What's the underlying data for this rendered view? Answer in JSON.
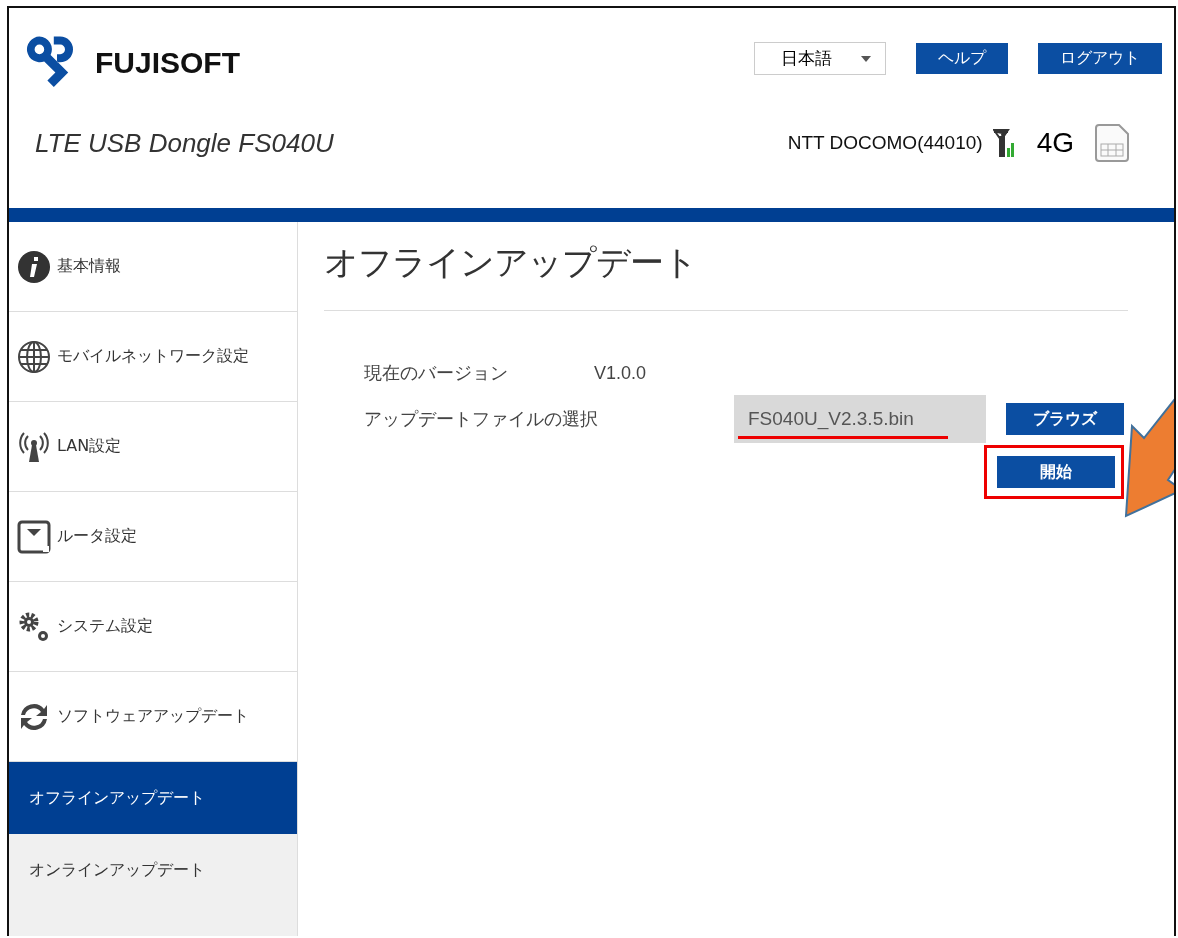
{
  "header": {
    "brand": "FUJISOFT",
    "product": "LTE USB Dongle FS040U",
    "language": "日本語",
    "buttons": [
      "ヘルプ",
      "ログアウト"
    ],
    "carrier": "NTT DOCOMO(44010)",
    "network": "4G"
  },
  "sidebar": {
    "items": [
      {
        "kind": "menu",
        "label": "基本情報",
        "selected": false
      },
      {
        "kind": "menu",
        "label": "モバイルネットワーク設定",
        "selected": false
      },
      {
        "kind": "menu",
        "label": "LAN設定",
        "selected": false
      },
      {
        "kind": "menu",
        "label": "ルータ設定",
        "selected": false
      },
      {
        "kind": "menu",
        "label": "システム設定",
        "selected": false
      },
      {
        "kind": "menu",
        "label": "ソフトウェアアップデート",
        "selected": false
      },
      {
        "kind": "submenu",
        "label": "オフラインアップデート",
        "selected": true
      },
      {
        "kind": "submenu",
        "label": "オンラインアップデート",
        "selected": false
      }
    ]
  },
  "content": {
    "title": "オフラインアップデート",
    "version_label": "現在のバージョン",
    "version": "V1.0.0",
    "file_label": "アップデートファイルの選択",
    "file": "FS040U_V2.3.5.bin",
    "browse": "ブラウズ",
    "start": "開始"
  }
}
